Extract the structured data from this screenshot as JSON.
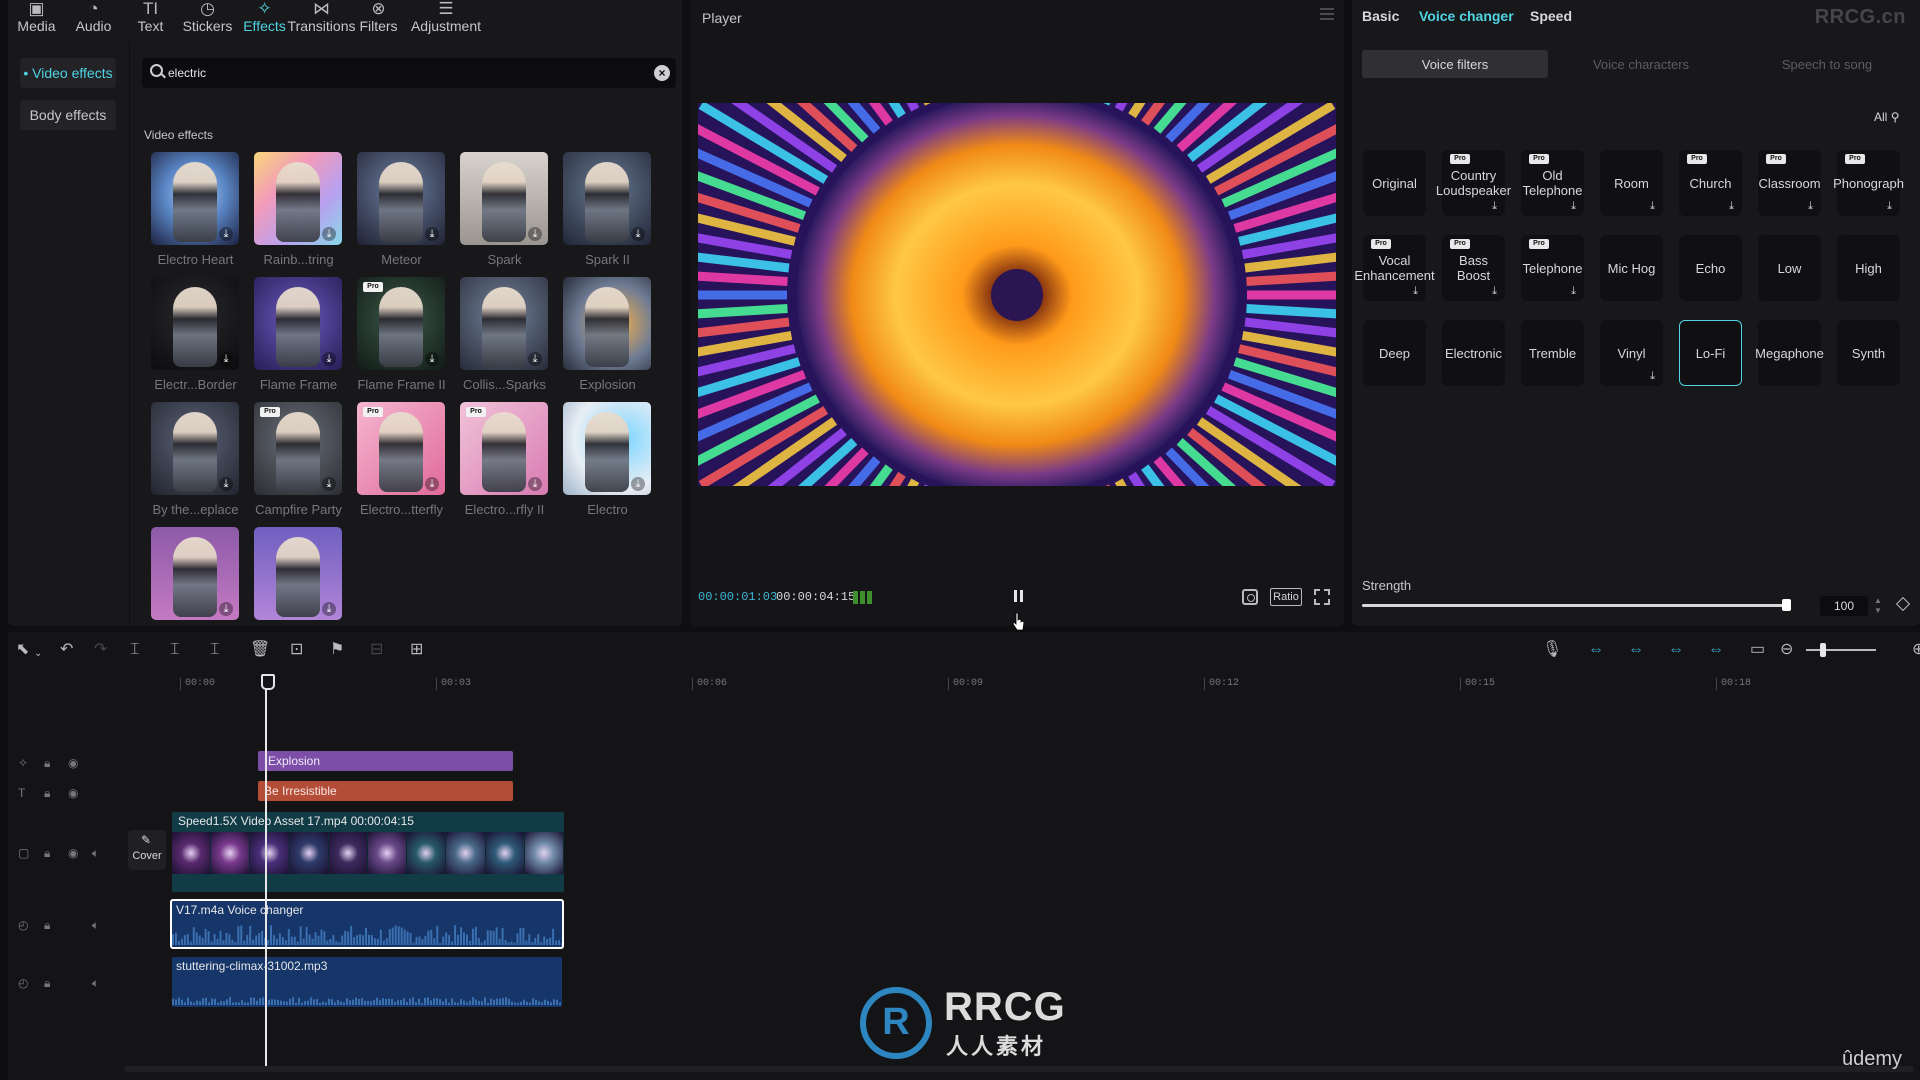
{
  "colors": {
    "accent": "#4fd4e3",
    "explosion_clip": "#7c4ea8",
    "text_clip": "#b44d38",
    "video_clip": "#113c46",
    "audio_clip": "#16366a"
  },
  "top_tabs": [
    {
      "label": "Media",
      "icon": "media-icon"
    },
    {
      "label": "Audio",
      "icon": "audio-icon"
    },
    {
      "label": "Text",
      "icon": "text-icon"
    },
    {
      "label": "Stickers",
      "icon": "stickers-icon"
    },
    {
      "label": "Effects",
      "icon": "effects-icon"
    },
    {
      "label": "Transitions",
      "icon": "transitions-icon"
    },
    {
      "label": "Filters",
      "icon": "filters-icon"
    },
    {
      "label": "Adjustment",
      "icon": "adjustment-icon"
    }
  ],
  "effects_sidebar": {
    "video_effects": "• Video effects",
    "body_effects": "Body effects"
  },
  "search": {
    "value": "electric"
  },
  "effects_section": {
    "heading": "Video effects",
    "items": [
      {
        "label": "Electro Heart"
      },
      {
        "label": "Rainb...tring"
      },
      {
        "label": "Meteor"
      },
      {
        "label": "Spark"
      },
      {
        "label": "Spark II"
      },
      {
        "label": "Electr...Border"
      },
      {
        "label": "Flame Frame"
      },
      {
        "label": "Flame Frame II"
      },
      {
        "label": "Collis...Sparks"
      },
      {
        "label": "Explosion"
      },
      {
        "label": "By the...eplace"
      },
      {
        "label": "Campfire Party"
      },
      {
        "label": "Electro...tterfly"
      },
      {
        "label": "Electro...rfly II"
      },
      {
        "label": "Electro"
      },
      {
        "label": ""
      },
      {
        "label": ""
      }
    ]
  },
  "player": {
    "title": "Player",
    "time_current": "00:00:01:03",
    "time_total": "00:00:04:15",
    "ratio_label": "Ratio"
  },
  "right_panel": {
    "tabs": {
      "basic": "Basic",
      "voice_changer": "Voice changer",
      "speed": "Speed"
    },
    "brand": "RRCG.cn",
    "subtabs": {
      "voice_filters": "Voice filters",
      "voice_characters": "Voice characters",
      "speech_to_song": "Speech to song"
    },
    "all_filter": "All",
    "voice_filters": [
      {
        "label": "Original"
      },
      {
        "label": "Country Loudspeaker"
      },
      {
        "label": "Old Telephone"
      },
      {
        "label": "Room"
      },
      {
        "label": "Church"
      },
      {
        "label": "Classroom"
      },
      {
        "label": "Phonograph"
      },
      {
        "label": "Vocal Enhancement"
      },
      {
        "label": "Bass Boost"
      },
      {
        "label": "Telephone"
      },
      {
        "label": "Mic Hog"
      },
      {
        "label": "Echo"
      },
      {
        "label": "Low"
      },
      {
        "label": "High"
      },
      {
        "label": "Deep"
      },
      {
        "label": "Electronic"
      },
      {
        "label": "Tremble"
      },
      {
        "label": "Vinyl"
      },
      {
        "label": "Lo-Fi"
      },
      {
        "label": "Megaphone"
      },
      {
        "label": "Synth"
      }
    ],
    "strength": {
      "label": "Strength",
      "value": "100",
      "fraction": 1.0
    }
  },
  "timeline": {
    "ruler": [
      "00:00",
      "00:03",
      "00:06",
      "00:09",
      "00:12",
      "00:15",
      "00:18"
    ],
    "clips": {
      "explosion": "Explosion",
      "text": "Be Irresistible",
      "video_header": "Speed1.5X  Video Asset 17.mp4  00:00:04:15",
      "audio_header": "V17.m4a    Voice changer",
      "music_header": "stuttering-climax-31002.mp3"
    },
    "cover_label": "Cover"
  },
  "watermark": {
    "title": "RRCG",
    "subtitle": "人人素材"
  },
  "udemy": "ûdemy"
}
